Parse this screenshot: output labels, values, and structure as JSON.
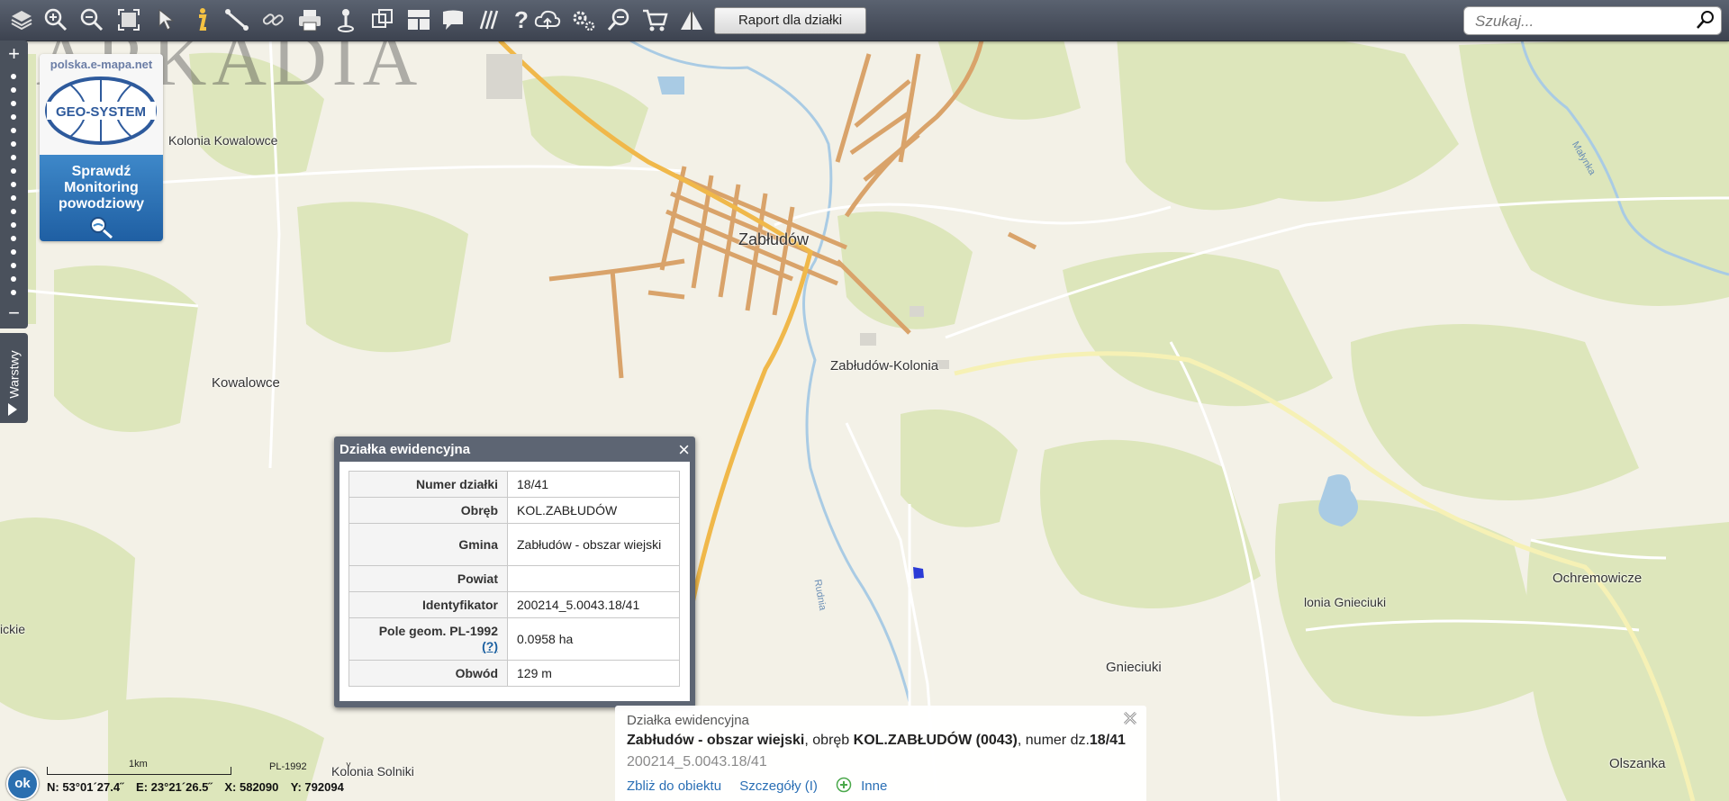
{
  "toolbar": {
    "icons": [
      "layers-icon",
      "zoom-in-icon",
      "zoom-out-icon",
      "zoom-extent-icon",
      "pointer-icon",
      "info-icon",
      "measure-distance-icon",
      "link-icon",
      "print-icon",
      "map-pin-icon",
      "overlay-icon",
      "layout-icon",
      "speech-bubble-icon",
      "hatch-icon",
      "help-icon",
      "cloud-upload-icon",
      "settings-icon",
      "magnifier-zoom-icon",
      "cart-icon",
      "warning-icon"
    ],
    "raport_label": "Raport dla działki"
  },
  "search": {
    "placeholder": "Szukaj..."
  },
  "watermark": "ARKADIA",
  "logo": {
    "site": "polska.e-mapa.net",
    "brand": "GEO-SYSTEM",
    "text_lines": [
      "Sprawdź",
      "Monitoring",
      "powodziowy"
    ]
  },
  "sidebar": {
    "zoom_in": "+",
    "zoom_out": "−",
    "layers_tab": "Warstwy"
  },
  "map_labels": {
    "zabludow": "Zabłudów",
    "kolonia_kowalowce": "Kolonia Kowalowce",
    "kowalowce": "Kowalowce",
    "zabludow_kolonia": "Zabłudów-Kolonia",
    "ochremowicze": "Ochremowicze",
    "kolonia_gnieciuki": "lonia Gnieciuki",
    "gnieciuki": "Gnieciuki",
    "olszanka": "Olszanka",
    "kolonia_solniki": "Kolonia Solniki",
    "left_edge": "ickie",
    "river_rudnia": "Rudnia",
    "river_malynka": "Małynka"
  },
  "parcel_popup": {
    "title": "Działka ewidencyjna",
    "close": "×",
    "rows": [
      {
        "label": "Numer działki",
        "value": "18/41"
      },
      {
        "label": "Obręb",
        "value": "KOL.ZABŁUDÓW"
      },
      {
        "label": "Gmina",
        "value": "Zabłudów - obszar wiejski"
      },
      {
        "label": "Powiat",
        "value": ""
      },
      {
        "label": "Identyfikator",
        "value": "200214_5.0043.18/41"
      },
      {
        "label": "Pole geom. PL-1992",
        "value": "0.0958 ha"
      },
      {
        "label": "Obwód",
        "value": "129 m"
      }
    ],
    "help_link": "(?)"
  },
  "info_panel": {
    "category": "Działka ewidencyjna",
    "gmina": "Zabłudów - obszar wiejski",
    "obreb_prefix": ", obręb ",
    "obreb": "KOL.ZABŁUDÓW (0043)",
    "numer_prefix": ", numer dz.",
    "numer": "18/41",
    "identifier": "200214_5.0043.18/41",
    "actions": {
      "zoom": "Zbliż do obiektu",
      "details": "Szczegóły (I)",
      "other": "Inne"
    }
  },
  "status": {
    "ok": "ok",
    "scale": "1km",
    "crs": "PL-1992",
    "crs_arrow": "˅",
    "coords": {
      "n": "N: 53°01´27.4˝",
      "e": "E: 23°21´26.5˝",
      "x": "X: 582090",
      "y": "Y: 792094"
    }
  },
  "colors": {
    "toolbar": "#4b525f",
    "road_main": "#f0b84a",
    "road_local": "#d9a36a",
    "forest": "#d8e2b4",
    "water": "#9cc4e2",
    "parcel": "#2a3bd6"
  }
}
